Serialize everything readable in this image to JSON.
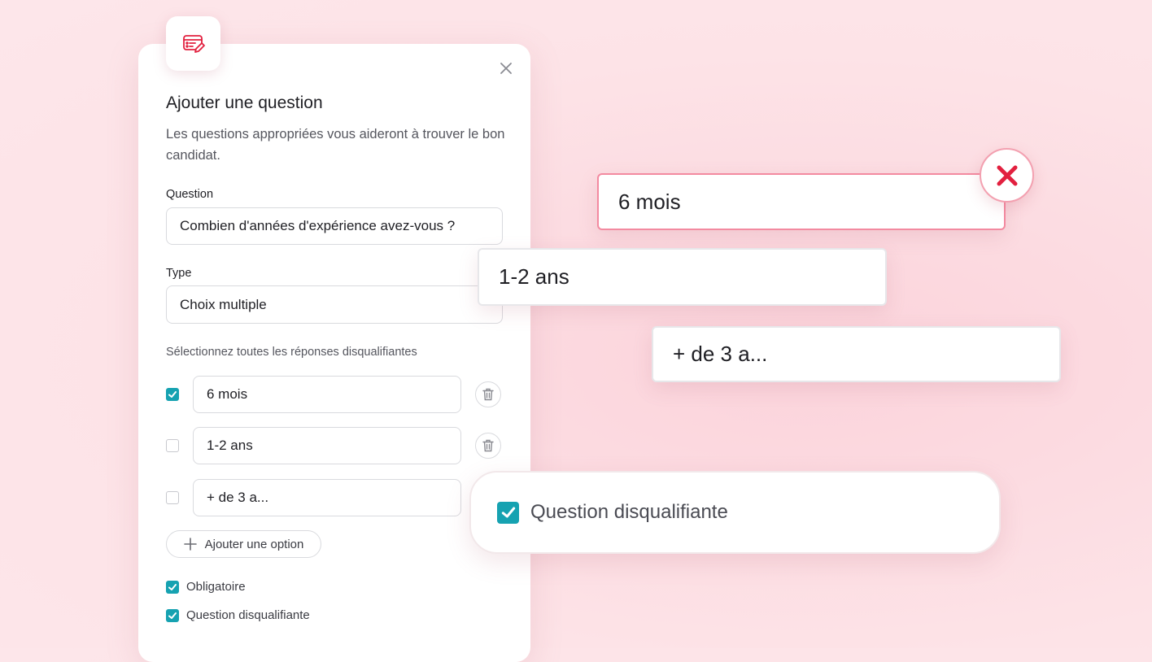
{
  "dialog": {
    "title": "Ajouter une question",
    "subtitle": "Les questions appropriées vous aideront à trouver le bon candidat.",
    "question_label": "Question",
    "question_value": "Combien d'années d'expérience avez-vous ?",
    "type_label": "Type",
    "type_value": "Choix multiple",
    "disqualify_instruction": "Sélectionnez toutes les réponses disqualifiantes",
    "options": [
      {
        "label": "6 mois",
        "checked": true
      },
      {
        "label": "1-2 ans",
        "checked": false
      },
      {
        "label": "+ de 3 a...",
        "checked": false
      }
    ],
    "add_option_label": "Ajouter une option",
    "required_label": "Obligatoire",
    "required_checked": true,
    "disqualifying_label": "Question disqualifiante",
    "disqualifying_checked": true
  },
  "floating": {
    "answer_rejected": "6 mois",
    "answer_2": "1-2 ans",
    "answer_3": "+ de 3 a...",
    "disqualifying_pill_label": "Question disqualifiante"
  },
  "colors": {
    "accent_teal": "#16a2b1",
    "brand_red": "#e2203f",
    "reject_border": "#f38aa0"
  },
  "icons": [
    "form-edit-icon",
    "close-icon",
    "trash-icon",
    "plus-icon",
    "check-icon",
    "reject-x-icon",
    "chevron-icon"
  ]
}
